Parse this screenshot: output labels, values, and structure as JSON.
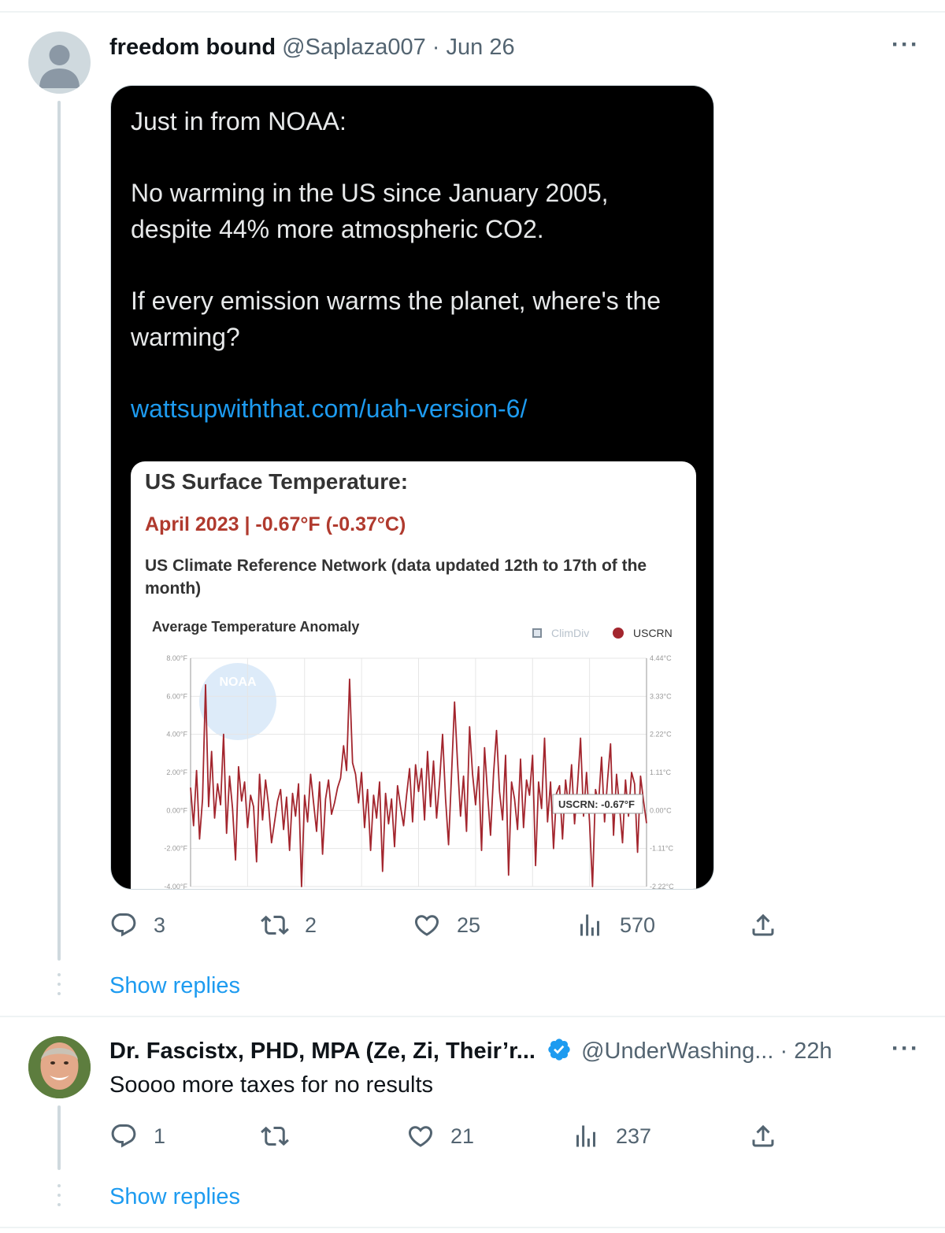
{
  "tweet1": {
    "author_name": "freedom bound",
    "handle": "@Saplaza007",
    "separator": "·",
    "date": "Jun 26",
    "more": "···",
    "media_text": {
      "line1": "Just in from NOAA:",
      "line2": "No warming in the US since January 2005,",
      "line3": "despite 44% more atmospheric CO2.",
      "line4": "If every emission warms the planet, where's the",
      "line5": "warming?",
      "link": "wattsupwiththat.com/uah-version-6/"
    },
    "card": {
      "title": "US Surface Temperature:",
      "subtitle": "April 2023 | -0.67°F (-0.37°C)",
      "description": "US Climate Reference Network (data updated 12th to 17th of the month)",
      "watermark": "NOAA"
    },
    "stats": {
      "replies": "3",
      "retweets": "2",
      "likes": "25",
      "views": "570"
    },
    "show_replies": "Show replies"
  },
  "tweet2": {
    "author_name": "Dr. Fascistx, PHD, MPA (Ze, Zi, Their’r...",
    "handle": "@UnderWashing...",
    "separator": "·",
    "time": "22h",
    "more": "···",
    "text": "Soooo more taxes for no results",
    "stats": {
      "replies": "1",
      "retweets": "",
      "likes": "21",
      "views": "237"
    },
    "show_replies": "Show replies"
  },
  "colors": {
    "accent": "#1d9bf0",
    "verified": "#1d9bf0",
    "series": "#a3262e",
    "muted": "#536471"
  },
  "chart_data": {
    "type": "line",
    "title": "Average Temperature Anomaly",
    "legend": [
      "ClimDiv",
      "USCRN"
    ],
    "y_left_ticks": [
      "8.00°F",
      "6.00°F",
      "4.00°F",
      "2.00°F",
      "0.00°F",
      "-2.00°F",
      "-4.00°F"
    ],
    "y_right_ticks": [
      "4.44°C",
      "3.33°C",
      "2.22°C",
      "1.11°C",
      "0.00°C",
      "-1.11°C",
      "-2.22°C"
    ],
    "ylim": [
      -4,
      8
    ],
    "tooltip": "USCRN: -0.67°F",
    "series": [
      {
        "name": "USCRN",
        "values": [
          1.2,
          -0.8,
          2.1,
          -1.5,
          0.6,
          6.6,
          0.2,
          3.1,
          -0.4,
          1.4,
          0.3,
          4.0,
          -1.2,
          1.8,
          0.1,
          -2.6,
          2.3,
          0.5,
          1.5,
          -0.9,
          0.8,
          0.2,
          -2.7,
          1.9,
          -0.5,
          1.6,
          0.3,
          -1.7,
          -0.6,
          0.5,
          1.1,
          -1.0,
          0.7,
          -2.1,
          0.9,
          -0.3,
          1.4,
          -4.0,
          0.8,
          -0.6,
          1.9,
          0.4,
          -1.1,
          1.5,
          -2.3,
          0.6,
          1.6,
          -0.2,
          0.4,
          1.2,
          1.7,
          3.4,
          2.1,
          6.9,
          2.5,
          1.9,
          0.4,
          2.0,
          -0.9,
          1.1,
          -2.1,
          0.8,
          -0.4,
          1.5,
          -3.2,
          0.9,
          -0.7,
          0.6,
          -1.9,
          1.3,
          0.2,
          -0.8,
          0.8,
          2.2,
          -0.6,
          2.4,
          1.0,
          2.2,
          -0.5,
          3.1,
          0.2,
          2.6,
          -0.4,
          1.5,
          4.0,
          0.6,
          -1.8,
          1.9,
          5.7,
          2.5,
          -0.3,
          1.8,
          -1.1,
          4.4,
          1.9,
          0.3,
          2.3,
          -2.1,
          3.3,
          0.9,
          -1.3,
          1.9,
          4.2,
          1.0,
          -0.5,
          2.9,
          -3.4,
          1.5,
          0.6,
          -1.0,
          2.7,
          -0.9,
          1.6,
          0.8,
          2.9,
          -2.9,
          1.5,
          0.1,
          3.8,
          -0.6,
          1.5,
          -2.0,
          0.9,
          1.3,
          -1.5,
          1.6,
          0.2,
          2.4,
          -0.7,
          1.3,
          3.8,
          -0.3,
          2.0,
          -0.6,
          -4.0,
          1.1,
          0.4,
          2.8,
          -0.6,
          1.6,
          3.5,
          -1.3,
          1.9,
          0.2,
          -1.7,
          1.6,
          -0.3,
          2.0,
          1.4,
          -2.2,
          1.8,
          0.5,
          -0.67
        ]
      }
    ]
  }
}
